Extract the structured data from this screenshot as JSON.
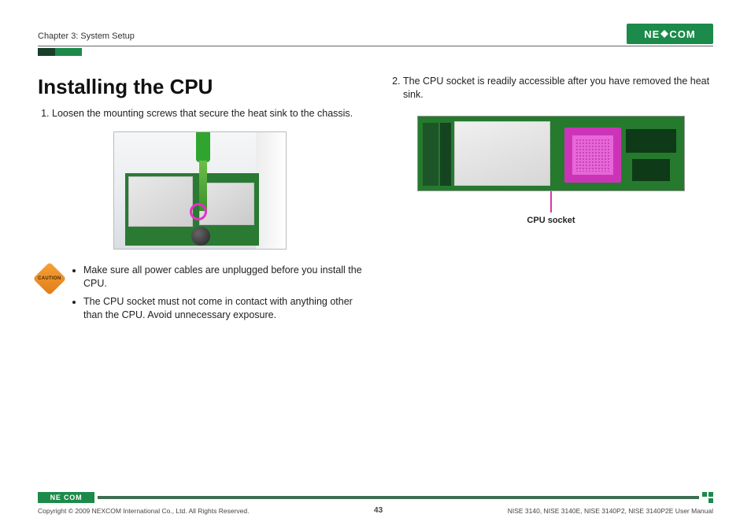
{
  "header": {
    "chapter": "Chapter 3: System Setup",
    "logo_left": "NE",
    "logo_right": "COM"
  },
  "left": {
    "title": "Installing the CPU",
    "step1": "Loosen the mounting screws that secure the heat sink to the chassis.",
    "caution_icon_text": "CAUTION",
    "caution_b1": "Make sure all power cables are unplugged before you install the CPU.",
    "caution_b2": "The CPU socket must not come in contact with anything other than the CPU. Avoid unnecessary exposure."
  },
  "right": {
    "step2": "The CPU socket is readily accessible after you have removed the heat sink.",
    "fig2_label": "CPU socket"
  },
  "footer": {
    "logo": "NE COM",
    "copyright": "Copyright © 2009 NEXCOM International Co., Ltd. All Rights Reserved.",
    "page": "43",
    "manual": "NISE 3140, NISE 3140E, NISE 3140P2, NISE 3140P2E User Manual"
  }
}
